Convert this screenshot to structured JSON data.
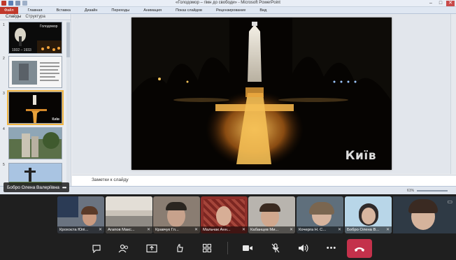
{
  "window": {
    "title": "«Голодомор – гімн до свободи» - Microsoft PowerPoint",
    "controls": [
      "–",
      "□",
      "✕"
    ]
  },
  "ribbon": {
    "tabs": [
      "Файл",
      "Главная",
      "Вставка",
      "Дизайн",
      "Переходы",
      "Анимация",
      "Показ слайдов",
      "Рецензирование",
      "Вид"
    ]
  },
  "slide_panel": {
    "tabs": [
      "Слайды",
      "Структура"
    ],
    "thumbnails": [
      {
        "number": "1",
        "text": "Голодомор",
        "years": "1932 – 1933"
      },
      {
        "number": "2"
      },
      {
        "number": "3",
        "caption": "Київ"
      },
      {
        "number": "4"
      },
      {
        "number": "5"
      }
    ]
  },
  "slide": {
    "caption": "Київ"
  },
  "notes": {
    "placeholder": "Заметки к слайду"
  },
  "statusbar": {
    "zoom": "61%"
  },
  "presenter": {
    "name": "Бобро Олена Валеріївна",
    "more": "•••"
  },
  "participants": [
    {
      "name": "Крохоєта Юлі..."
    },
    {
      "name": "Агапов Макс..."
    },
    {
      "name": "Кравчук Гл..."
    },
    {
      "name": "Мальчак Анн..."
    },
    {
      "name": "Кабанцев Ми..."
    },
    {
      "name": "Кочерга Н. С..."
    },
    {
      "name": "Бобро Олена В..."
    }
  ],
  "controls": {
    "chat": "chat-icon",
    "people": "people-icon",
    "share": "share-screen-icon",
    "reactions": "reactions-icon",
    "rooms": "apps-icon",
    "camera": "camera-icon",
    "mic": "mic-off-icon",
    "speaker": "speaker-icon",
    "more": "•••",
    "leave": "hang-up-icon"
  },
  "colors": {
    "teams_bg": "#1f1f1f",
    "leave_red": "#c4314b",
    "file_tab": "#c0392b",
    "selected_thumb": "#f2b642"
  }
}
